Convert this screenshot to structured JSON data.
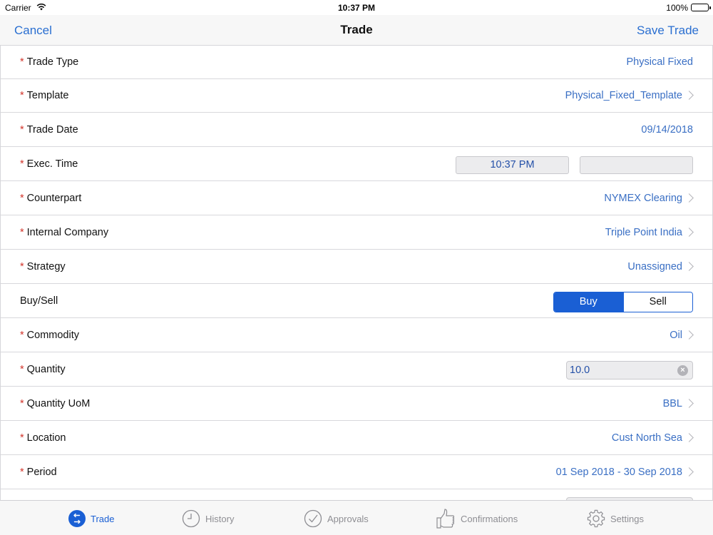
{
  "status_bar": {
    "carrier": "Carrier",
    "time": "10:37 PM",
    "battery": "100%"
  },
  "nav": {
    "cancel_label": "Cancel",
    "title": "Trade",
    "save_label": "Save Trade"
  },
  "form": {
    "required_marker": "*",
    "trade_type": {
      "label": "Trade Type",
      "value": "Physical Fixed"
    },
    "template": {
      "label": "Template",
      "value": "Physical_Fixed_Template"
    },
    "trade_date": {
      "label": "Trade Date",
      "value": "09/14/2018"
    },
    "exec_time": {
      "label": "Exec. Time",
      "value": "10:37 PM",
      "second_value": ""
    },
    "counterpart": {
      "label": "Counterpart",
      "value": "NYMEX Clearing"
    },
    "internal_company": {
      "label": "Internal Company",
      "value": "Triple Point India"
    },
    "strategy": {
      "label": "Strategy",
      "value": "Unassigned"
    },
    "buy_sell": {
      "label": "Buy/Sell",
      "options": [
        "Buy",
        "Sell"
      ],
      "selected": "Buy"
    },
    "commodity": {
      "label": "Commodity",
      "value": "Oil"
    },
    "quantity": {
      "label": "Quantity",
      "value": "10.0"
    },
    "quantity_uom": {
      "label": "Quantity UoM",
      "value": "BBL"
    },
    "location": {
      "label": "Location",
      "value": "Cust North Sea"
    },
    "period": {
      "label": "Period",
      "value": "01 Sep 2018 - 30 Sep 2018"
    }
  },
  "tabs": [
    {
      "label": "Trade",
      "icon": "trade-arrows-icon",
      "active": true
    },
    {
      "label": "History",
      "icon": "clock-icon",
      "active": false
    },
    {
      "label": "Approvals",
      "icon": "checkmark-circle-icon",
      "active": false
    },
    {
      "label": "Confirmations",
      "icon": "thumbs-up-icon",
      "active": false
    },
    {
      "label": "Settings",
      "icon": "gear-icon",
      "active": false
    }
  ],
  "colors": {
    "accent": "#1a5fd4",
    "link": "#2a6fd1",
    "value_text": "#3a6fc4",
    "required": "#d2352b"
  }
}
